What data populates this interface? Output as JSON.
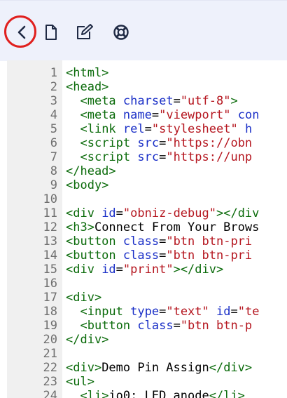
{
  "toolbar": {
    "back_icon": "chevron-left-icon",
    "file_icon": "file-icon",
    "edit_icon": "edit-icon",
    "help_icon": "lifebuoy-icon",
    "highlight_color": "#e0201e"
  },
  "editor": {
    "lines": [
      {
        "n": "1",
        "tokens": [
          {
            "t": "tag",
            "v": "<html>"
          }
        ]
      },
      {
        "n": "2",
        "tokens": [
          {
            "t": "tag",
            "v": "<head>"
          }
        ]
      },
      {
        "n": "3",
        "tokens": [
          {
            "t": "text",
            "v": "  "
          },
          {
            "t": "tag",
            "v": "<meta "
          },
          {
            "t": "attr",
            "v": "charset"
          },
          {
            "t": "text",
            "v": "="
          },
          {
            "t": "str",
            "v": "\"utf-8\""
          },
          {
            "t": "tag",
            "v": ">"
          }
        ]
      },
      {
        "n": "4",
        "tokens": [
          {
            "t": "text",
            "v": "  "
          },
          {
            "t": "tag",
            "v": "<meta "
          },
          {
            "t": "attr",
            "v": "name"
          },
          {
            "t": "text",
            "v": "="
          },
          {
            "t": "str",
            "v": "\"viewport\""
          },
          {
            "t": "text",
            "v": " "
          },
          {
            "t": "attr",
            "v": "con"
          }
        ]
      },
      {
        "n": "5",
        "tokens": [
          {
            "t": "text",
            "v": "  "
          },
          {
            "t": "tag",
            "v": "<link "
          },
          {
            "t": "attr",
            "v": "rel"
          },
          {
            "t": "text",
            "v": "="
          },
          {
            "t": "str",
            "v": "\"stylesheet\""
          },
          {
            "t": "text",
            "v": " "
          },
          {
            "t": "attr",
            "v": "h"
          }
        ]
      },
      {
        "n": "6",
        "tokens": [
          {
            "t": "text",
            "v": "  "
          },
          {
            "t": "tag",
            "v": "<script "
          },
          {
            "t": "attr",
            "v": "src"
          },
          {
            "t": "text",
            "v": "="
          },
          {
            "t": "str",
            "v": "\"https://obn"
          }
        ]
      },
      {
        "n": "7",
        "tokens": [
          {
            "t": "text",
            "v": "  "
          },
          {
            "t": "tag",
            "v": "<script "
          },
          {
            "t": "attr",
            "v": "src"
          },
          {
            "t": "text",
            "v": "="
          },
          {
            "t": "str",
            "v": "\"https://unp"
          }
        ]
      },
      {
        "n": "8",
        "tokens": [
          {
            "t": "tag",
            "v": "</head>"
          }
        ]
      },
      {
        "n": "9",
        "tokens": [
          {
            "t": "tag",
            "v": "<body>"
          }
        ]
      },
      {
        "n": "10",
        "tokens": []
      },
      {
        "n": "11",
        "tokens": [
          {
            "t": "tag",
            "v": "<div "
          },
          {
            "t": "attr",
            "v": "id"
          },
          {
            "t": "text",
            "v": "="
          },
          {
            "t": "str",
            "v": "\"obniz-debug\""
          },
          {
            "t": "tag",
            "v": "></div"
          }
        ]
      },
      {
        "n": "12",
        "tokens": [
          {
            "t": "tag",
            "v": "<h3>"
          },
          {
            "t": "text",
            "v": "Connect From Your Brows"
          }
        ]
      },
      {
        "n": "13",
        "tokens": [
          {
            "t": "tag",
            "v": "<button "
          },
          {
            "t": "attr",
            "v": "class"
          },
          {
            "t": "text",
            "v": "="
          },
          {
            "t": "str",
            "v": "\"btn btn-pri"
          }
        ]
      },
      {
        "n": "14",
        "tokens": [
          {
            "t": "tag",
            "v": "<button "
          },
          {
            "t": "attr",
            "v": "class"
          },
          {
            "t": "text",
            "v": "="
          },
          {
            "t": "str",
            "v": "\"btn btn-pri"
          }
        ]
      },
      {
        "n": "15",
        "tokens": [
          {
            "t": "tag",
            "v": "<div "
          },
          {
            "t": "attr",
            "v": "id"
          },
          {
            "t": "text",
            "v": "="
          },
          {
            "t": "str",
            "v": "\"print\""
          },
          {
            "t": "tag",
            "v": "></div>"
          }
        ]
      },
      {
        "n": "16",
        "tokens": []
      },
      {
        "n": "17",
        "tokens": [
          {
            "t": "tag",
            "v": "<div>"
          }
        ]
      },
      {
        "n": "18",
        "tokens": [
          {
            "t": "text",
            "v": "  "
          },
          {
            "t": "tag",
            "v": "<input "
          },
          {
            "t": "attr",
            "v": "type"
          },
          {
            "t": "text",
            "v": "="
          },
          {
            "t": "str",
            "v": "\"text\""
          },
          {
            "t": "text",
            "v": " "
          },
          {
            "t": "attr",
            "v": "id"
          },
          {
            "t": "text",
            "v": "="
          },
          {
            "t": "str",
            "v": "\"te"
          }
        ]
      },
      {
        "n": "19",
        "tokens": [
          {
            "t": "text",
            "v": "  "
          },
          {
            "t": "tag",
            "v": "<button "
          },
          {
            "t": "attr",
            "v": "class"
          },
          {
            "t": "text",
            "v": "="
          },
          {
            "t": "str",
            "v": "\"btn btn-p"
          }
        ]
      },
      {
        "n": "20",
        "tokens": [
          {
            "t": "tag",
            "v": "</div>"
          }
        ]
      },
      {
        "n": "21",
        "tokens": []
      },
      {
        "n": "22",
        "tokens": [
          {
            "t": "tag",
            "v": "<div>"
          },
          {
            "t": "text",
            "v": "Demo Pin Assign"
          },
          {
            "t": "tag",
            "v": "</div>"
          }
        ]
      },
      {
        "n": "23",
        "tokens": [
          {
            "t": "tag",
            "v": "<ul>"
          }
        ]
      },
      {
        "n": "24",
        "tokens": [
          {
            "t": "text",
            "v": "  "
          },
          {
            "t": "tag",
            "v": "<li>"
          },
          {
            "t": "text",
            "v": "io0: LED anode"
          },
          {
            "t": "tag",
            "v": "</li>"
          }
        ]
      }
    ],
    "colors": {
      "tag": "#0b6b0b",
      "attr": "#1a2fc7",
      "str": "#b5161f",
      "text": "#000000",
      "line_number": "#6f6f6f",
      "gutter": "#f0f0f0"
    }
  }
}
